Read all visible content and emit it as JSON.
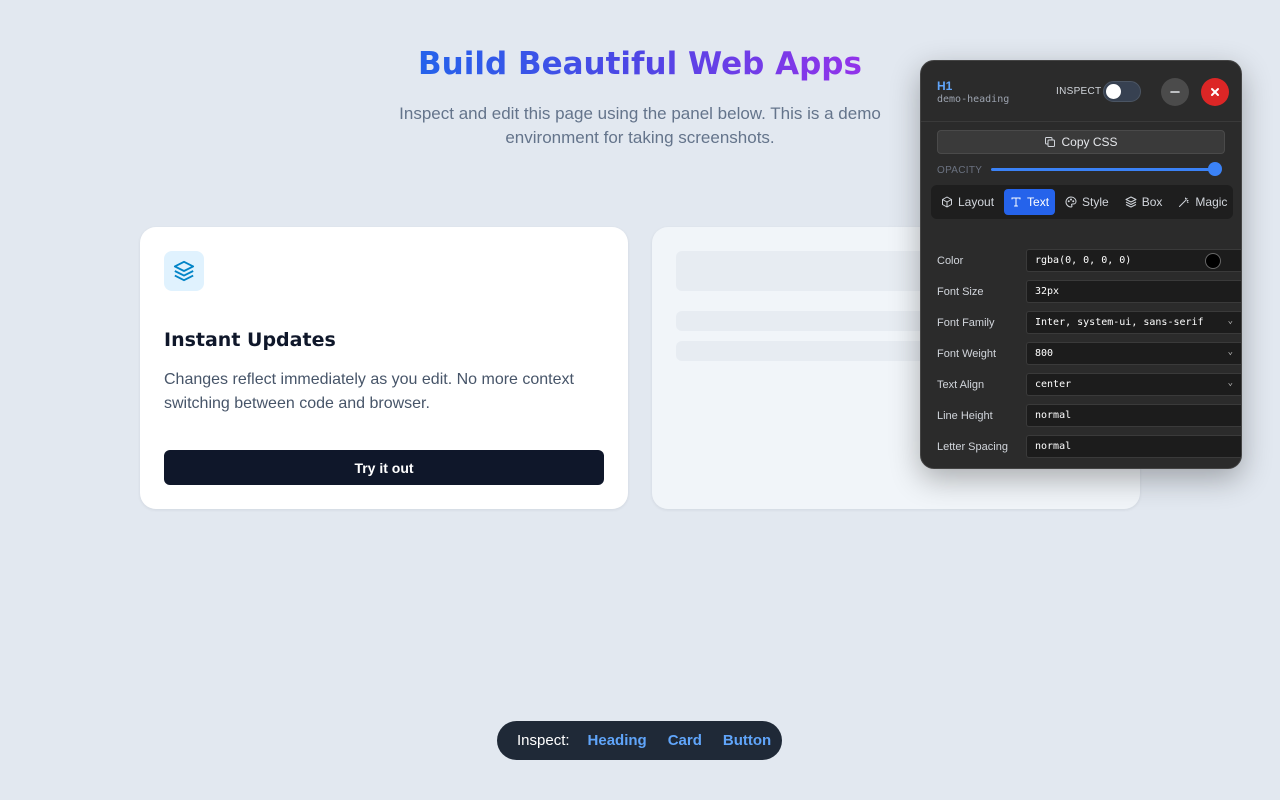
{
  "hero": {
    "title": "Build Beautiful Web Apps",
    "subtitle": "Inspect and edit this page using the panel below. This is a demo environment for taking screenshots."
  },
  "card": {
    "icon": "layers-icon",
    "title": "Instant Updates",
    "description": "Changes reflect immediately as you edit. No more context switching between code and browser.",
    "button_label": "Try it out"
  },
  "inspect_bar": {
    "label": "Inspect:",
    "links": [
      "Heading",
      "Card",
      "Button"
    ]
  },
  "panel": {
    "tag": "H1",
    "element_id": "demo-heading",
    "inspect_label": "INSPECT",
    "inspect_enabled": false,
    "copy_label": "Copy CSS",
    "opacity_label": "OPACITY",
    "opacity_value": 1.0,
    "tabs": [
      {
        "label": "Layout",
        "icon": "cube-icon"
      },
      {
        "label": "Text",
        "icon": "text-icon",
        "active": true
      },
      {
        "label": "Style",
        "icon": "palette-icon"
      },
      {
        "label": "Box",
        "icon": "layers-icon"
      },
      {
        "label": "Magic",
        "icon": "wand-icon"
      }
    ],
    "properties": [
      {
        "name": "Color",
        "value": "rgba(0, 0, 0, 0)"
      },
      {
        "name": "Font Size",
        "value": "32px"
      },
      {
        "name": "Font Family",
        "value": "Inter, system-ui, sans-serif"
      },
      {
        "name": "Font Weight",
        "value": "800"
      },
      {
        "name": "Text Align",
        "value": "center"
      },
      {
        "name": "Line Height",
        "value": "normal"
      },
      {
        "name": "Letter Spacing",
        "value": "normal"
      }
    ]
  },
  "colors": {
    "background": "#e2e8f0",
    "accent": "#2563eb",
    "danger": "#dc2626",
    "gradient_start": "#2563eb",
    "gradient_end": "#9333ea"
  }
}
